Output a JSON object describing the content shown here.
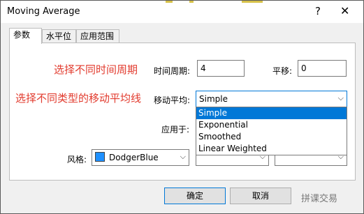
{
  "window": {
    "title": "Moving Average",
    "help": "?",
    "close": "✕"
  },
  "tabs": [
    "参数",
    "水平位",
    "应用范围"
  ],
  "annotations": {
    "period_note": "选择不同时间周期",
    "type_note": "选择不同类型的移动平均线"
  },
  "fields": {
    "period": {
      "label": "时间周期:",
      "value": "4"
    },
    "shift": {
      "label": "平移:",
      "value": "0"
    },
    "ma_method": {
      "label": "移动平均:",
      "value": "Simple",
      "options": [
        "Simple",
        "Exponential",
        "Smoothed",
        "Linear Weighted"
      ],
      "selected_index": 0
    },
    "apply_to": {
      "label": "应用于:"
    },
    "style": {
      "label": "风格:",
      "color_name": "DodgerBlue",
      "color": "#1e90ff"
    }
  },
  "buttons": {
    "ok": "确定",
    "cancel": "取消"
  },
  "watermark": "拼课交易"
}
